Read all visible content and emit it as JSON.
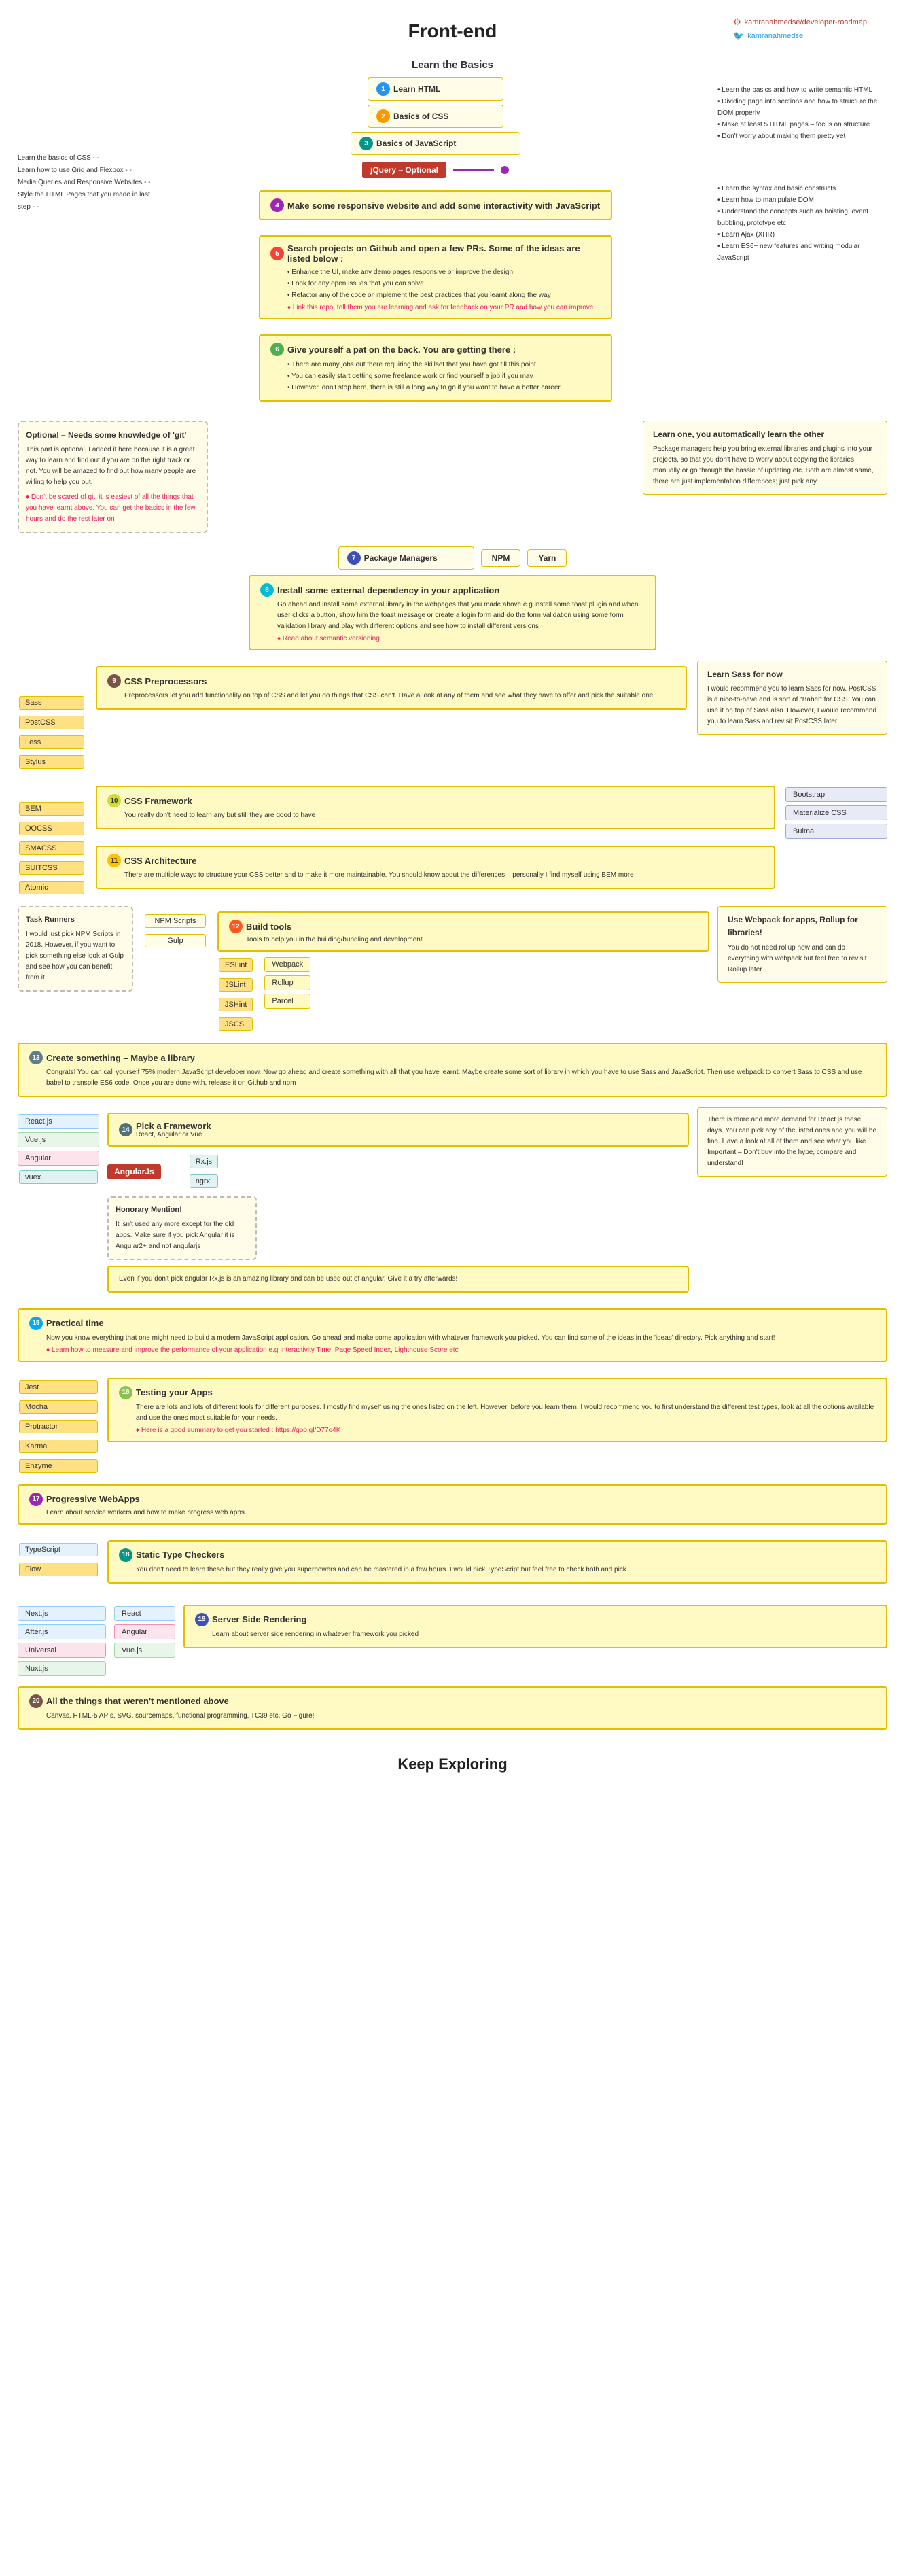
{
  "header": {
    "title": "Front-end",
    "social": {
      "github": "kamranahmedse/developer-roadmap",
      "twitter": "kamranahmedse"
    }
  },
  "learn_basics": {
    "title": "Learn the Basics",
    "steps": [
      {
        "num": "1",
        "label": "Learn HTML",
        "color": "blue"
      },
      {
        "num": "2",
        "label": "Basics of CSS",
        "color": "orange"
      },
      {
        "num": "3",
        "label": "Basics of JavaScript",
        "color": "teal"
      }
    ],
    "left_bullets": [
      "Learn the basics of CSS",
      "Learn how to use Grid and Flexbox",
      "Media Queries and Responsive Websites",
      "Style the HTML Pages that you made in last step"
    ],
    "html_bullets": [
      "Learn the basics and how to write semantic HTML",
      "Dividing page into sections and how to structure the DOM properly",
      "Make at least 5 HTML pages – focus on structure",
      "Don't worry about making them pretty yet"
    ],
    "js_bullets": [
      "Learn the syntax and basic constructs",
      "Learn how to manipulate DOM",
      "Understand the concepts such as hoisting, event bubbling, prototype etc",
      "Learn Ajax (XHR)",
      "Learn ES6+ new features and writing modular JavaScript"
    ],
    "jquery_optional": "jQuery – Optional",
    "step4": {
      "num": "4",
      "label": "Make some responsive website and add some interactivity with JavaScript",
      "color": "purple"
    },
    "step5": {
      "num": "5",
      "label": "Search projects on Github and open a few PRs. Some of the ideas are listed below :",
      "color": "red",
      "bullets": [
        "Enhance the UI, make any demo pages responsive or improve the design",
        "Look for any open issues that you can solve",
        "Refactor any of the code or implement the best practices that you learnt along the way"
      ],
      "hint": "Link this repo, tell them you are learning and ask for feedback on your PR and how you can improve"
    },
    "step6": {
      "num": "6",
      "label": "Give yourself a pat on the back. You are getting there :",
      "color": "green",
      "bullets": [
        "There are many jobs out there requiring the skillset that you have got till this point",
        "You can easily start getting some freelance work or find yourself a job if you may",
        "However, don't stop here, there is still a long way to go if you want to have a better career"
      ]
    }
  },
  "optional_git": {
    "title": "Optional – Needs some knowledge of 'git'",
    "body": "This part is optional, I added it here because it is a great way to learn and find out if you are on the right track or not. You will be amazed to find out how many people are willing to help you out.",
    "hint": "Don't be scared of git, it is easiest of all the things that you have learnt above. You can get the basics in the few hours and do the rest later on"
  },
  "learn_one_auto": {
    "title": "Learn one, you automatically learn the other",
    "body": "Package managers help you bring external libraries and plugins into your projects, so that you don't have to worry about copying the libraries manually or go through the hassle of updating etc. Both are almost same, there are just implementation differences; just pick any"
  },
  "package_managers": {
    "num": "7",
    "label": "Package Managers",
    "color": "indigo",
    "npm": "NPM",
    "yarn": "Yarn"
  },
  "step8": {
    "num": "8",
    "label": "Install some external dependency in your application",
    "color": "cyan",
    "body": "Go ahead and install some external library in the webpages that you made above e.g install some toast plugin and when user clicks a button, show him the toast message or create a login form and do the form validation using some form validation library and play with different options and see how to install different versions",
    "hint": "Read about semantic versioning"
  },
  "css_preprocessors": {
    "num": "9",
    "label": "CSS Preprocessors",
    "color": "brown",
    "body": "Preprocessors let you add functionality on top of CSS and let you do things that CSS can't. Have a look at any of them and see what they have to offer and pick the suitable one",
    "tags": [
      "Sass",
      "PostCSS",
      "Less",
      "Stylus"
    ],
    "right_info": {
      "title": "Learn Sass for now",
      "body": "I would recommend you to learn Sass for now. PostCSS is a nice-to-have and is sort of \"Babel\" for CSS. You can use it on top of Sass also. However, I would recommend you to learn Sass and revisit PostCSS later"
    }
  },
  "css_framework": {
    "num": "10",
    "label": "CSS Framework",
    "color": "lime",
    "body": "You really don't need to learn any but still they are good to have",
    "left_tags": [
      "BEM",
      "OOCSS",
      "SMACSS",
      "SUITCSS",
      "Atomic"
    ],
    "right_tags": [
      "Bootstrap",
      "Materialize CSS",
      "Bulma"
    ]
  },
  "css_architecture": {
    "num": "11",
    "label": "CSS Architecture",
    "color": "amber",
    "body": "There are multiple ways to structure your CSS better and to make it more maintainable. You should know about the differences – personally I find myself using BEM more"
  },
  "build_tools": {
    "task_runners": {
      "title": "Task Runners",
      "body": "I would just pick NPM Scripts in 2018. However, if you want to pick something else look at Gulp and see how you can benefit from it"
    },
    "npm_scripts": "NPM Scripts",
    "gulp": "Gulp",
    "section": {
      "num": "12",
      "label": "Build tools",
      "color": "deeporange",
      "body": "Tools to help you in the building/bundling and development"
    },
    "linters": [
      "ESLint",
      "JSLint",
      "JSHint",
      "JSCS"
    ],
    "bundlers": [
      "Webpack",
      "Rollup",
      "Parcel"
    ],
    "right_info": {
      "title": "Use Webpack for apps, Rollup for libraries!",
      "body": "You do not need rollup now and can do everything with webpack but feel free to revisit Rollup later"
    }
  },
  "create_something": {
    "num": "13",
    "label": "Create something – Maybe a library",
    "color": "grey",
    "body": "Congrats! You can call yourself 75% modern JavaScript developer now. Now go ahead and create something with all that you have learnt. Maybe create some sort of library in which you have to use Sass and JavaScript. Then use webpack to convert Sass to CSS and use babel to transpile ES6 code. Once you are done with, release it on Github and npm"
  },
  "pick_framework": {
    "num": "14",
    "label": "Pick a Framework",
    "sublabel": "React, Angular or Vue",
    "color": "bluegrey",
    "right_info": {
      "body": "There is more and more demand for React.js these days. You can pick any of the listed ones and you will be fine. Have a look at all of them and see what you like. Important – Don't buy into the hype, compare and understand!"
    },
    "tags": [
      "React.js",
      "Vue.js",
      "Angular"
    ],
    "vuex": "vuex",
    "angularjs_badge": "AngularJs",
    "rxjs": "Rx.js",
    "ngrx": "ngrx",
    "honorary": {
      "title": "Honorary Mention!",
      "body": "It isn't used any more except for the old apps. Make sure if you pick Angular it is Angular2+ and not angularjs"
    },
    "even_if": "Even if you don't pick angular Rx.js is an amazing library and can be used out of angular. Give it a try afterwards!"
  },
  "practical_time": {
    "num": "15",
    "label": "Practical time",
    "color": "lightblue",
    "body": "Now you know everything that one might need to build a modern JavaScript application. Go ahead and make some application with whatever framework you picked. You can find some of the ideas in the 'ideas' directory. Pick anything and start!",
    "hint": "Learn how to measure and improve the performance of your application e.g Interactivity Time, Page Speed Index, Lighthouse Score etc"
  },
  "testing_apps": {
    "num": "16",
    "label": "Testing your Apps",
    "color": "lightgreen",
    "body": "There are lots and lots of different tools for different purposes. I mostly find myself using the ones listed on the left. However, before you learn them, I would recommend you to first understand the different test types, look at all the options available and use the ones most suitable for your needs.",
    "hint": "Here is a good summary to get you started : https://goo.gl/D77o4K",
    "tools": [
      "Jest",
      "Mocha",
      "Protractor",
      "Karma",
      "Enzyme"
    ]
  },
  "progressive_webapps": {
    "num": "17",
    "label": "Progressive WebApps",
    "color": "purple",
    "body": "Learn about service workers and how to make progress web apps"
  },
  "static_type_checkers": {
    "num": "18",
    "label": "Static Type Checkers",
    "color": "teal",
    "body": "You don't need to learn these but they really give you superpowers and can be mastered in a few hours. I would pick TypeScript but feel free to check both and pick",
    "tools": [
      "TypeScript",
      "Flow"
    ]
  },
  "ssr": {
    "num": "19",
    "label": "Server Side Rendering",
    "color": "indigo",
    "body": "Learn about server side rendering in whatever framework you picked",
    "frameworks": {
      "react": [
        "Next.js",
        "After.js"
      ],
      "angular": [
        "Universal"
      ],
      "vue": [
        "Nuxt.js"
      ],
      "generic": [
        "React",
        "Angular",
        "Vue.js"
      ]
    }
  },
  "all_things": {
    "num": "20",
    "label": "All the things that weren't mentioned above",
    "color": "brown",
    "body": "Canvas, HTML-5 APIs, SVG, sourcemaps, functional programming, TC39 etc. Go Figure!"
  },
  "keep_exploring": "Keep Exploring"
}
